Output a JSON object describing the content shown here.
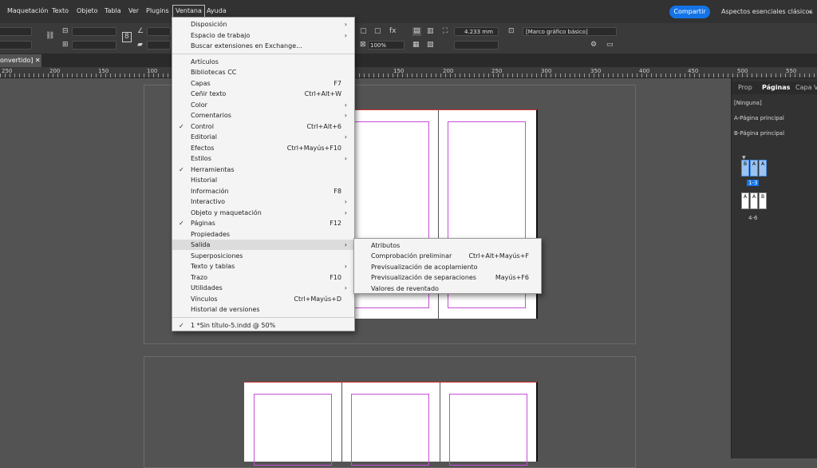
{
  "menubar": {
    "items": [
      "Maquetación",
      "Texto",
      "Objeto",
      "Tabla",
      "Ver",
      "Plugins",
      "Ventana",
      "Ayuda"
    ],
    "share_label": "Compartir",
    "workspace_label": "Aspectos esenciales clásicos"
  },
  "control": {
    "dimension_value": "4.233 mm",
    "zoom_value": "100%",
    "frame_style": "[Marco gráfico básico]"
  },
  "document": {
    "tab_label": "onvertido] ✕"
  },
  "ruler": {
    "labels": [
      "250",
      "200",
      "150",
      "100",
      "150",
      "200",
      "250",
      "300",
      "350",
      "400",
      "450",
      "500",
      "550"
    ]
  },
  "ventana_menu": {
    "items": [
      {
        "label": "Disposición",
        "shortcut": "",
        "arrow": true,
        "checked": false
      },
      {
        "label": "Espacio de trabajo",
        "shortcut": "",
        "arrow": true,
        "checked": false
      },
      {
        "label": "Buscar extensiones en Exchange...",
        "shortcut": "",
        "arrow": false,
        "checked": false
      },
      {
        "label": "Artículos",
        "shortcut": "",
        "arrow": false,
        "checked": false
      },
      {
        "label": "Bibliotecas CC",
        "shortcut": "",
        "arrow": false,
        "checked": false
      },
      {
        "label": "Capas",
        "shortcut": "F7",
        "arrow": false,
        "checked": false
      },
      {
        "label": "Ceñir texto",
        "shortcut": "Ctrl+Alt+W",
        "arrow": false,
        "checked": false
      },
      {
        "label": "Color",
        "shortcut": "",
        "arrow": true,
        "checked": false
      },
      {
        "label": "Comentarios",
        "shortcut": "",
        "arrow": true,
        "checked": false
      },
      {
        "label": "Control",
        "shortcut": "Ctrl+Alt+6",
        "arrow": false,
        "checked": true
      },
      {
        "label": "Editorial",
        "shortcut": "",
        "arrow": true,
        "checked": false
      },
      {
        "label": "Efectos",
        "shortcut": "Ctrl+Mayús+F10",
        "arrow": false,
        "checked": false
      },
      {
        "label": "Estilos",
        "shortcut": "",
        "arrow": true,
        "checked": false
      },
      {
        "label": "Herramientas",
        "shortcut": "",
        "arrow": false,
        "checked": true
      },
      {
        "label": "Historial",
        "shortcut": "",
        "arrow": false,
        "checked": false
      },
      {
        "label": "Información",
        "shortcut": "F8",
        "arrow": false,
        "checked": false
      },
      {
        "label": "Interactivo",
        "shortcut": "",
        "arrow": true,
        "checked": false
      },
      {
        "label": "Objeto y maquetación",
        "shortcut": "",
        "arrow": true,
        "checked": false
      },
      {
        "label": "Páginas",
        "shortcut": "F12",
        "arrow": false,
        "checked": true
      },
      {
        "label": "Propiedades",
        "shortcut": "",
        "arrow": false,
        "checked": false
      },
      {
        "label": "Salida",
        "shortcut": "",
        "arrow": true,
        "checked": false
      },
      {
        "label": "Superposiciones",
        "shortcut": "",
        "arrow": false,
        "checked": false
      },
      {
        "label": "Texto y tablas",
        "shortcut": "",
        "arrow": true,
        "checked": false
      },
      {
        "label": "Trazo",
        "shortcut": "F10",
        "arrow": false,
        "checked": false
      },
      {
        "label": "Utilidades",
        "shortcut": "",
        "arrow": true,
        "checked": false
      },
      {
        "label": "Vínculos",
        "shortcut": "Ctrl+Mayús+D",
        "arrow": false,
        "checked": false
      },
      {
        "label": "Historial de versiones",
        "shortcut": "",
        "arrow": false,
        "checked": false
      },
      {
        "label": "1 *Sin título-5.indd @ 50%",
        "shortcut": "",
        "arrow": false,
        "checked": true
      }
    ]
  },
  "salida_submenu": {
    "items": [
      {
        "label": "Atributos",
        "shortcut": ""
      },
      {
        "label": "Comprobación preliminar",
        "shortcut": "Ctrl+Alt+Mayús+F"
      },
      {
        "label": "Previsualización de acoplamiento",
        "shortcut": ""
      },
      {
        "label": "Previsualización de separaciones",
        "shortcut": "Mayús+F6"
      },
      {
        "label": "Valores de reventado",
        "shortcut": ""
      }
    ]
  },
  "pages_panel": {
    "tabs": [
      "Prop",
      "Páginas",
      "Capa",
      "V"
    ],
    "masters": [
      "[Ninguna]",
      "A-Página principal",
      "B-Página principal"
    ],
    "spread1_letters": [
      "B",
      "A",
      "A"
    ],
    "spread1_label": "1-3",
    "spread2_letters": [
      "A",
      "A",
      "B"
    ],
    "spread2_label": "4-6"
  },
  "colors": {
    "accent": "#1473e6",
    "margin_guide": "#c64ed6",
    "bleed_line": "#cc3333"
  }
}
